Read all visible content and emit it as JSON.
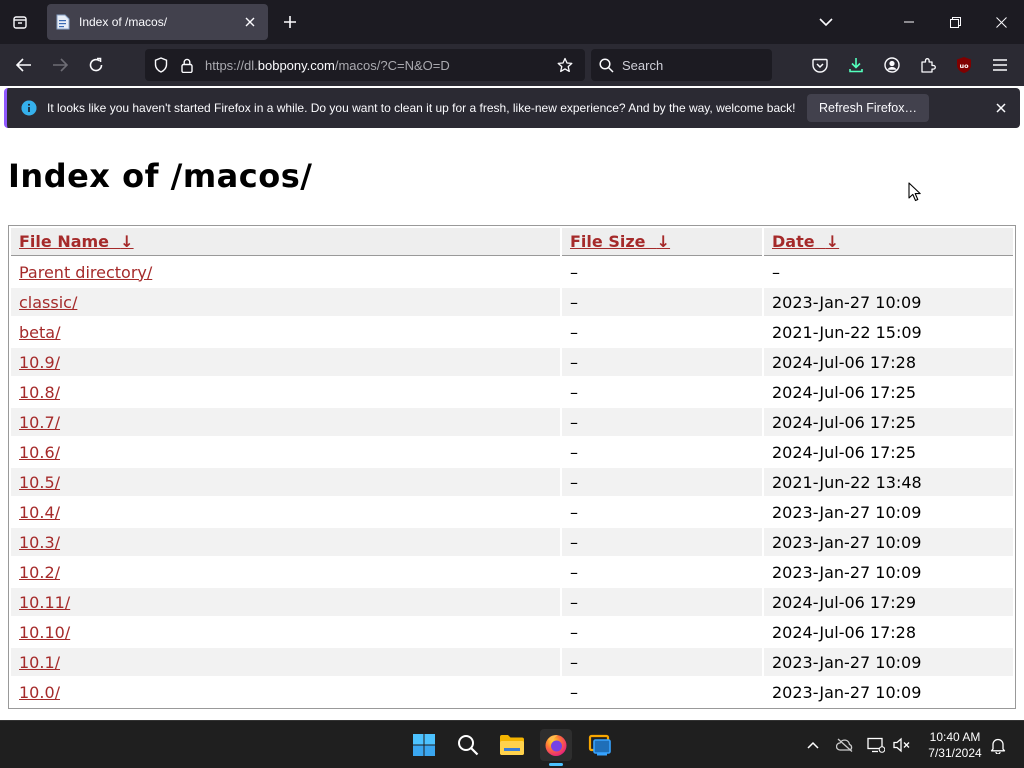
{
  "browser": {
    "tab": {
      "title": "Index of /macos/"
    },
    "url": {
      "prefix": "https://dl.",
      "host": "bobpony.com",
      "path": "/macos/?C=N&O=D"
    },
    "search": {
      "placeholder": "Search"
    },
    "extension_badge": "uo"
  },
  "notification": {
    "message": "It looks like you haven't started Firefox in a while. Do you want to clean it up for a fresh, like-new experience? And by the way, welcome back!",
    "button_label": "Refresh Firefox…"
  },
  "page": {
    "heading": "Index of /macos/",
    "columns": [
      {
        "label": "File Name",
        "sort": "↓"
      },
      {
        "label": "File Size",
        "sort": "↓"
      },
      {
        "label": "Date",
        "sort": "↓"
      }
    ],
    "rows": [
      {
        "name": "Parent directory/",
        "size": "–",
        "date": "–"
      },
      {
        "name": "classic/",
        "size": "–",
        "date": "2023-Jan-27 10:09"
      },
      {
        "name": "beta/",
        "size": "–",
        "date": "2021-Jun-22 15:09"
      },
      {
        "name": "10.9/",
        "size": "–",
        "date": "2024-Jul-06 17:28"
      },
      {
        "name": "10.8/",
        "size": "–",
        "date": "2024-Jul-06 17:25"
      },
      {
        "name": "10.7/",
        "size": "–",
        "date": "2024-Jul-06 17:25"
      },
      {
        "name": "10.6/",
        "size": "–",
        "date": "2024-Jul-06 17:25"
      },
      {
        "name": "10.5/",
        "size": "–",
        "date": "2021-Jun-22 13:48"
      },
      {
        "name": "10.4/",
        "size": "–",
        "date": "2023-Jan-27 10:09"
      },
      {
        "name": "10.3/",
        "size": "–",
        "date": "2023-Jan-27 10:09"
      },
      {
        "name": "10.2/",
        "size": "–",
        "date": "2023-Jan-27 10:09"
      },
      {
        "name": "10.11/",
        "size": "–",
        "date": "2024-Jul-06 17:29"
      },
      {
        "name": "10.10/",
        "size": "–",
        "date": "2024-Jul-06 17:28"
      },
      {
        "name": "10.1/",
        "size": "–",
        "date": "2023-Jan-27 10:09"
      },
      {
        "name": "10.0/",
        "size": "–",
        "date": "2023-Jan-27 10:09"
      }
    ]
  },
  "taskbar": {
    "time": "10:40 AM",
    "date": "7/31/2024"
  },
  "colors": {
    "link": "#a52a2a",
    "accent": "#9059ff",
    "download": "#54ffbd"
  }
}
